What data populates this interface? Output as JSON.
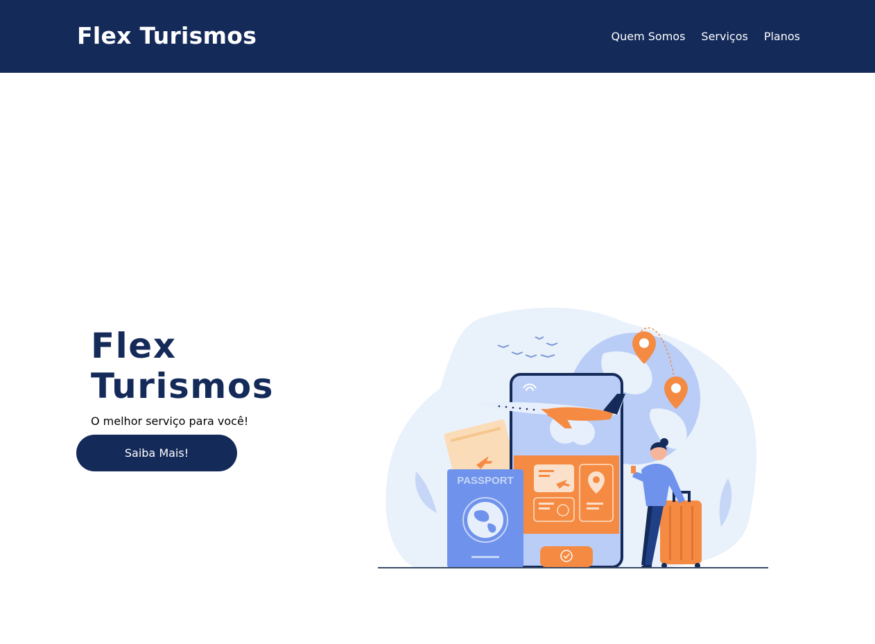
{
  "navbar": {
    "brand": "Flex Turismos",
    "links": [
      {
        "label": "Quem Somos"
      },
      {
        "label": "Serviços"
      },
      {
        "label": "Planos"
      }
    ]
  },
  "hero": {
    "title": "Flex Turismos",
    "subtitle": "O melhor serviço para você!",
    "cta_label": "Saiba Mais!"
  },
  "illustration": {
    "passport_text": "PASSPORT"
  },
  "colors": {
    "primary": "#142a59",
    "accent_orange": "#f58a42",
    "accent_blue": "#6f93ec",
    "light_blue": "#dfe9fb"
  }
}
